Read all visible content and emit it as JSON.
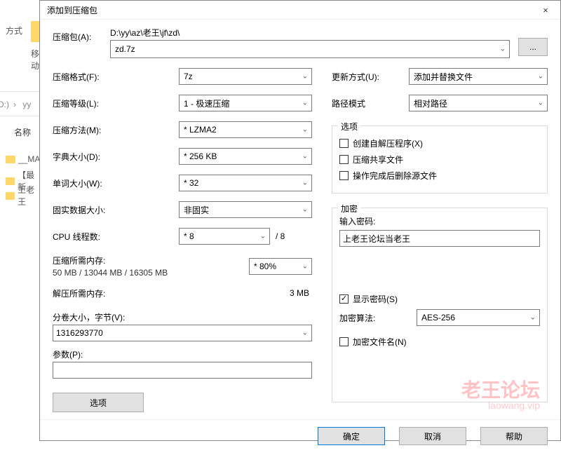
{
  "bg": {
    "format_lbl": "方式",
    "move_lbl": "移动",
    "bread_drive": "(D:)",
    "bread_chev": "›",
    "bread_yy": "yy",
    "name_header": "名称",
    "folders": [
      "__MA",
      "【最新",
      "上老王"
    ]
  },
  "dialog": {
    "title": "添加到压缩包",
    "close": "×",
    "archive_label": "压缩包(A):",
    "archive_path": "D:\\yy\\az\\老王\\jf\\zd\\",
    "archive_name": "zd.7z",
    "browse_label": "...",
    "left": {
      "format_lbl": "压缩格式(F):",
      "format_val": "7z",
      "level_lbl": "压缩等级(L):",
      "level_val": "1 - 极速压缩",
      "method_lbl": "压缩方法(M):",
      "method_val": "* LZMA2",
      "dict_lbl": "字典大小(D):",
      "dict_val": "* 256 KB",
      "word_lbl": "单词大小(W):",
      "word_val": "* 32",
      "solid_lbl": "固实数据大小:",
      "solid_val": "非固实",
      "cpu_lbl": "CPU 线程数:",
      "cpu_val": "* 8",
      "cpu_total": "/ 8",
      "compress_mem_lbl": "压缩所需内存:",
      "compress_mem_val": "50 MB / 13044 MB / 16305 MB",
      "mem_percent": "* 80%",
      "decompress_mem_lbl": "解压所需内存:",
      "decompress_mem_val": "3 MB",
      "volume_lbl": "分卷大小，字节(V):",
      "volume_val": "1316293770",
      "params_lbl": "参数(P):",
      "params_val": "",
      "options_btn": "选项"
    },
    "right": {
      "update_lbl": "更新方式(U):",
      "update_val": "添加并替换文件",
      "pathmode_lbl": "路径模式",
      "pathmode_val": "相对路径",
      "options_legend": "选项",
      "opt_sfx": "创建自解压程序(X)",
      "opt_share": "压缩共享文件",
      "opt_delete": "操作完成后删除源文件",
      "encrypt_legend": "加密",
      "pwd_lbl": "输入密码:",
      "pwd_val": "上老王论坛当老王",
      "show_pwd": "显示密码(S)",
      "enc_method_lbl": "加密算法:",
      "enc_method_val": "AES-256",
      "enc_filenames": "加密文件名(N)"
    },
    "footer": {
      "ok": "确定",
      "cancel": "取消",
      "help": "帮助"
    }
  },
  "watermark": {
    "text": "老王论坛",
    "sub": "laowang.vip"
  }
}
